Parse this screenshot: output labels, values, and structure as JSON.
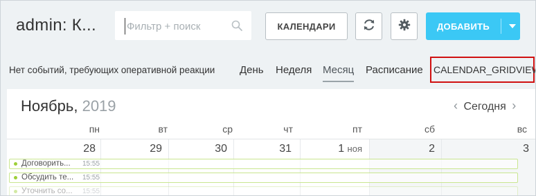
{
  "header": {
    "app_title": "admin: К...",
    "search": {
      "placeholder": "Фильтр + поиск",
      "value": ""
    },
    "calendars_label": "КАЛЕНДАРИ",
    "add_label": "ДОБАВИТЬ"
  },
  "subbar": {
    "notice": "Нет событий, требующих оперативной реакции",
    "views": [
      {
        "label": "День",
        "active": false
      },
      {
        "label": "Неделя",
        "active": false
      },
      {
        "label": "Месяц",
        "active": true
      },
      {
        "label": "Расписание",
        "active": false
      }
    ],
    "gridview": "CALENDAR_GRIDVIEW",
    "highlight_color": "#d01010"
  },
  "calendar": {
    "month": "Ноябрь,",
    "year": "2019",
    "today_label": "Сегодня",
    "weekdays": [
      "пн",
      "вт",
      "ср",
      "чт",
      "пт",
      "сб",
      "вс"
    ],
    "days": [
      {
        "num": "28",
        "month": ""
      },
      {
        "num": "29",
        "month": ""
      },
      {
        "num": "30",
        "month": ""
      },
      {
        "num": "31",
        "month": ""
      },
      {
        "num": "1",
        "month": "ноя"
      },
      {
        "num": "2",
        "month": ""
      },
      {
        "num": "3",
        "month": ""
      }
    ],
    "events": [
      {
        "title": "Договорить...",
        "time": "15:55"
      },
      {
        "title": "Обсудить те...",
        "time": "15:55"
      },
      {
        "title": "Уточнить со...",
        "time": "15:55"
      }
    ]
  },
  "colors": {
    "accent": "#3bc8f5",
    "event_dot": "#9dcf38",
    "event_border": "#c9e68f"
  }
}
